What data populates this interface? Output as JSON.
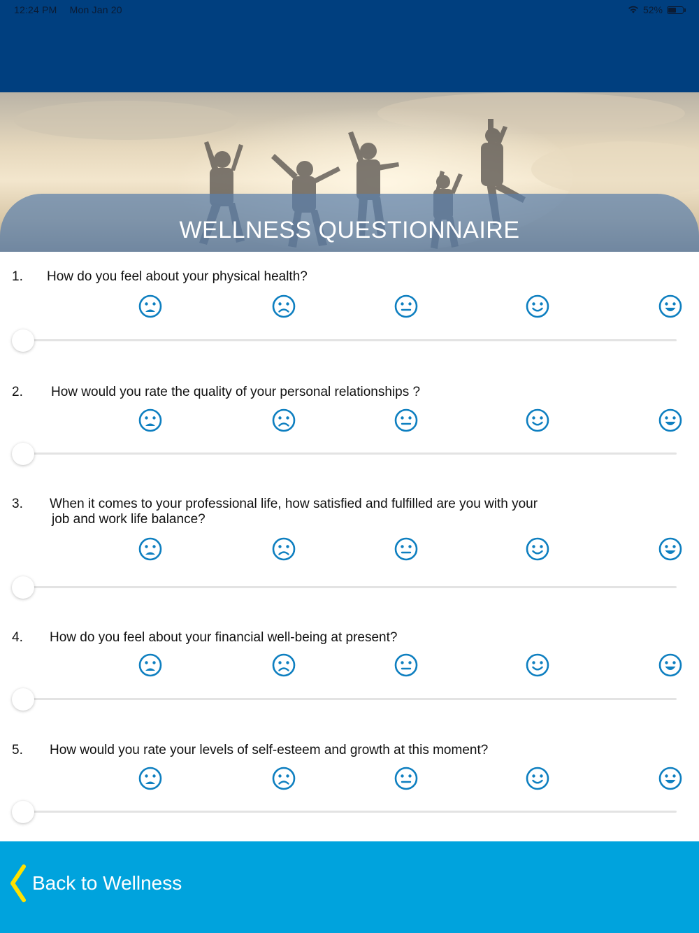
{
  "status_bar": {
    "time": "12:24 PM",
    "date": "Mon Jan 20",
    "battery": "52%",
    "battery_level": 0.52
  },
  "header": {
    "title": "WELLNESS QUESTIONNAIRE"
  },
  "rating_icons": [
    "very-sad-face-icon",
    "sad-face-icon",
    "neutral-face-icon",
    "happy-face-icon",
    "very-happy-face-icon"
  ],
  "accent_color": "#0E7FC0",
  "questions": [
    {
      "number": "1.",
      "line1": "How do you feel about your physical health?",
      "line2": "",
      "value": 0
    },
    {
      "number": "2.",
      "line1": "How would you rate the quality of your personal relationships ?",
      "line2": "",
      "value": 0
    },
    {
      "number": "3.",
      "line1": "When it comes to your professional life, how satisfied and fulfilled are you with your",
      "line2": "job and work life balance?",
      "value": 0
    },
    {
      "number": "4.",
      "line1": "How do you feel about your financial well-being at present?",
      "line2": "",
      "value": 0
    },
    {
      "number": "5.",
      "line1": "How would you rate your levels of self-esteem and growth at this moment?",
      "line2": "",
      "value": 0
    }
  ],
  "footer": {
    "back_label": "Back to Wellness",
    "chevron_color": "#FFE100"
  }
}
